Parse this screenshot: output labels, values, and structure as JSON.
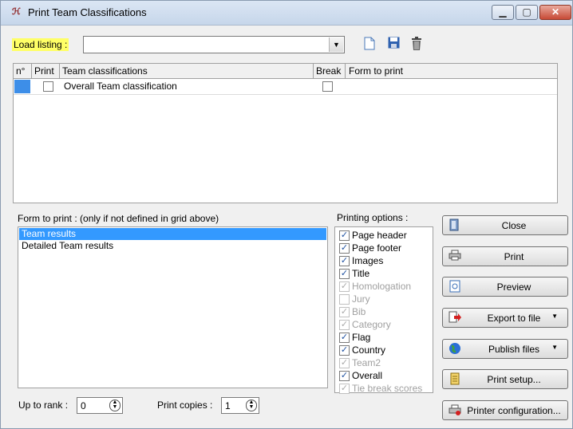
{
  "window": {
    "title": "Print Team Classifications",
    "icon": "print-team-app-icon",
    "controls": {
      "minimize": "▁",
      "maximize": "▢",
      "close": "✕"
    }
  },
  "toolbar": {
    "load_listing_label": "Load listing :",
    "load_listing_value": "",
    "icons": [
      "new-document-icon",
      "save-icon",
      "delete-icon"
    ]
  },
  "grid": {
    "columns": [
      "n°",
      "Print",
      "Team classifications",
      "Break",
      "Form to print"
    ],
    "rows": [
      {
        "n": "",
        "print": false,
        "name": "Overall Team classification",
        "break": false,
        "form": ""
      }
    ]
  },
  "form_to_print": {
    "label": "Form to print :  (only if not defined in grid above)",
    "items": [
      "Team results",
      "Detailed Team results"
    ],
    "selected": "Team results"
  },
  "printing_options": {
    "label": "Printing options :",
    "items": [
      {
        "label": "Page header",
        "checked": true,
        "enabled": true
      },
      {
        "label": "Page footer",
        "checked": true,
        "enabled": true
      },
      {
        "label": "Images",
        "checked": true,
        "enabled": true
      },
      {
        "label": "Title",
        "checked": true,
        "enabled": true
      },
      {
        "label": "Homologation",
        "checked": true,
        "enabled": false
      },
      {
        "label": "Jury",
        "checked": false,
        "enabled": false
      },
      {
        "label": "Bib",
        "checked": true,
        "enabled": false
      },
      {
        "label": "Category",
        "checked": true,
        "enabled": false
      },
      {
        "label": "Flag",
        "checked": true,
        "enabled": true
      },
      {
        "label": "Country",
        "checked": true,
        "enabled": true
      },
      {
        "label": "Team2",
        "checked": true,
        "enabled": false
      },
      {
        "label": "Overall",
        "checked": true,
        "enabled": true
      },
      {
        "label": "Tie break scores",
        "checked": true,
        "enabled": false
      }
    ]
  },
  "actions": {
    "close": "Close",
    "print": "Print",
    "preview": "Preview",
    "export": "Export to file",
    "publish": "Publish files",
    "print_setup": "Print setup...",
    "printer_config": "Printer configuration..."
  },
  "bottom": {
    "up_to_rank_label": "Up to rank :",
    "up_to_rank_value": "0",
    "print_copies_label": "Print copies :",
    "print_copies_value": "1"
  },
  "colors": {
    "highlight": "#ffff66",
    "selection": "#3399ff",
    "close_button": "#c74a36"
  }
}
